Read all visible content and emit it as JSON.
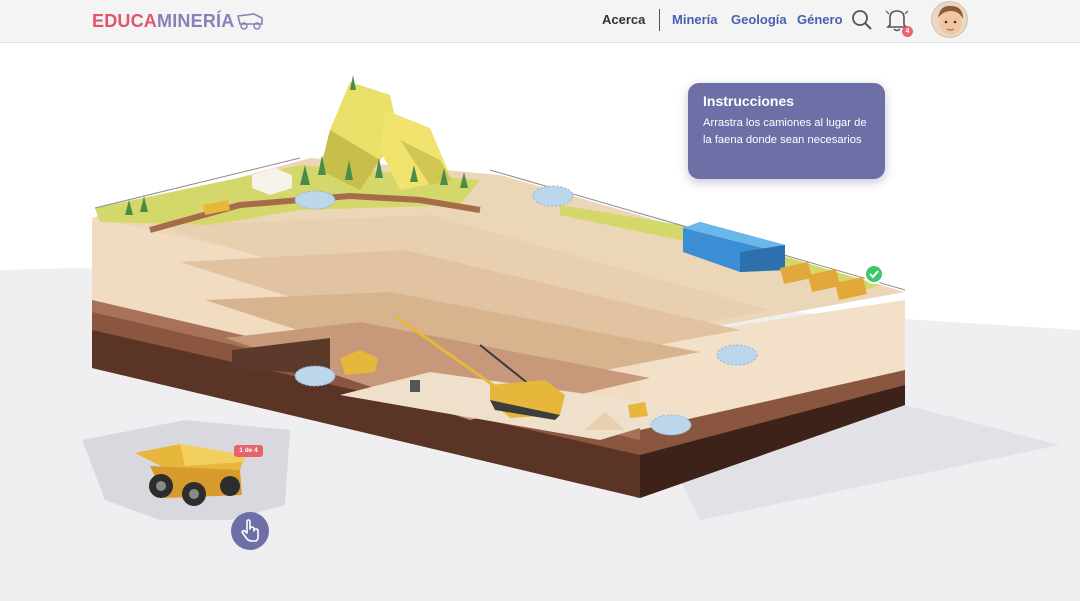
{
  "app": {
    "logo_part1": "EDUCA",
    "logo_part2": "MINERÍA"
  },
  "nav": {
    "about": "Acerca",
    "mining": "Minería",
    "geology": "Geología",
    "gender": "Género"
  },
  "notifications": {
    "count": "4"
  },
  "instructions": {
    "title": "Instrucciones",
    "body": "Arrastra los camiones al lugar de la faena donde sean necesarios"
  },
  "truck": {
    "counter": "1 de 4"
  },
  "colors": {
    "accent": "#6e6fa6",
    "logo_red": "#e0566a",
    "logo_purple": "#8b7fb8",
    "nav_link": "#4a5fb0",
    "badge": "#e8646b",
    "success": "#3bc86a"
  },
  "icons": [
    "truck-logo-icon",
    "search-icon",
    "bell-icon",
    "hand-pointer-icon",
    "check-icon"
  ]
}
